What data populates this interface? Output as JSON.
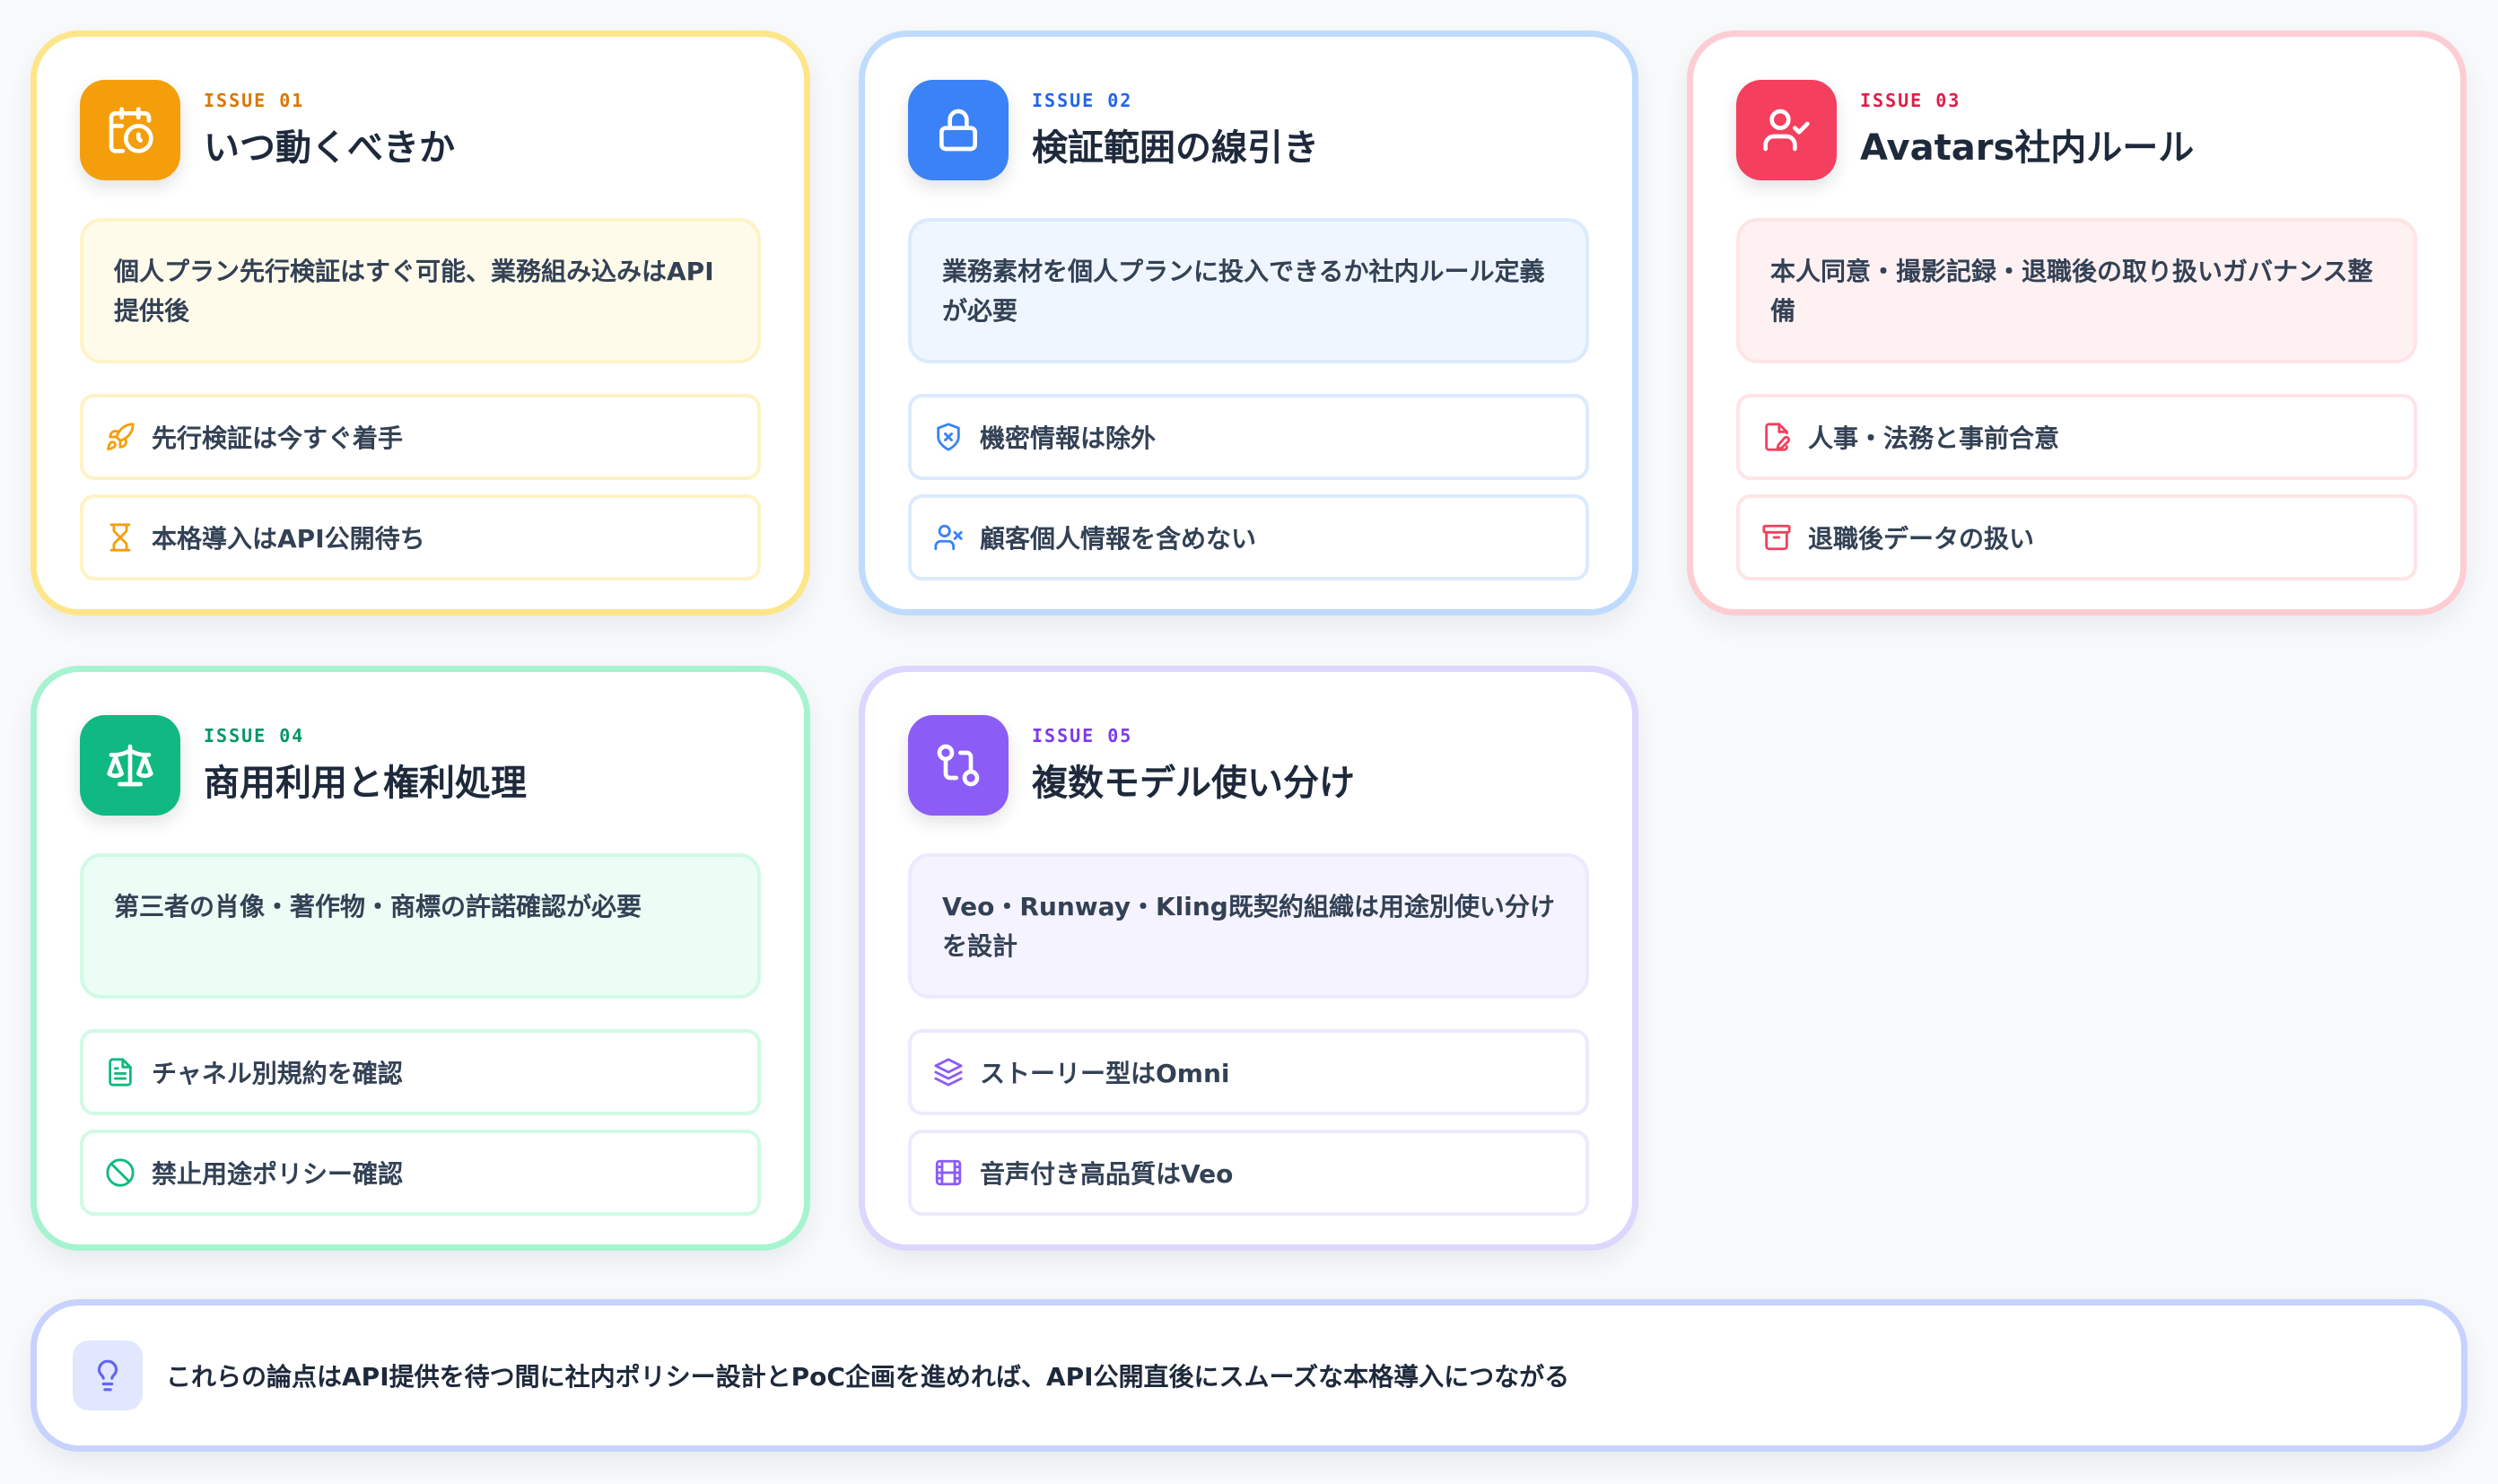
{
  "cards": [
    {
      "tag": "ISSUE 01",
      "title": "いつ動くべきか",
      "summary": "個人プラン先行検証はすぐ可能、業務組み込みはAPI提供後",
      "icon": "calendar-clock-icon",
      "color": "#f59e0b",
      "points": [
        {
          "icon": "rocket-icon",
          "label": "先行検証は今すぐ着手"
        },
        {
          "icon": "hourglass-icon",
          "label": "本格導入はAPI公開待ち"
        }
      ]
    },
    {
      "tag": "ISSUE 02",
      "title": "検証範囲の線引き",
      "summary": "業務素材を個人プランに投入できるか社内ルール定義が必要",
      "icon": "lock-icon",
      "color": "#3b82f6",
      "points": [
        {
          "icon": "shield-x-icon",
          "label": "機密情報は除外"
        },
        {
          "icon": "user-x-icon",
          "label": "顧客個人情報を含めない"
        }
      ]
    },
    {
      "tag": "ISSUE 03",
      "title": "Avatars社内ルール",
      "summary": "本人同意・撮影記録・退職後の取り扱いガバナンス整備",
      "icon": "user-check-icon",
      "color": "#f43f5e",
      "points": [
        {
          "icon": "file-signature-icon",
          "label": "人事・法務と事前合意"
        },
        {
          "icon": "archive-icon",
          "label": "退職後データの扱い"
        }
      ]
    },
    {
      "tag": "ISSUE 04",
      "title": "商用利用と権利処理",
      "summary": "第三者の肖像・著作物・商標の許諾確認が必要",
      "icon": "scale-icon",
      "color": "#10b981",
      "points": [
        {
          "icon": "file-text-icon",
          "label": "チャネル別規約を確認"
        },
        {
          "icon": "ban-icon",
          "label": "禁止用途ポリシー確認"
        }
      ]
    },
    {
      "tag": "ISSUE 05",
      "title": "複数モデル使い分け",
      "summary": "Veo・Runway・Kling既契約組織は用途別使い分けを設計",
      "icon": "git-compare-icon",
      "color": "#8b5cf6",
      "points": [
        {
          "icon": "layers-icon",
          "label": "ストーリー型はOmni"
        },
        {
          "icon": "film-icon",
          "label": "音声付き高品質はVeo"
        }
      ]
    }
  ],
  "footer": {
    "icon": "lightbulb-icon",
    "text": "これらの論点はAPI提供を待つ間に社内ポリシー設計とPoC企画を進めれば、API公開直後にスムーズな本格導入につながる"
  }
}
